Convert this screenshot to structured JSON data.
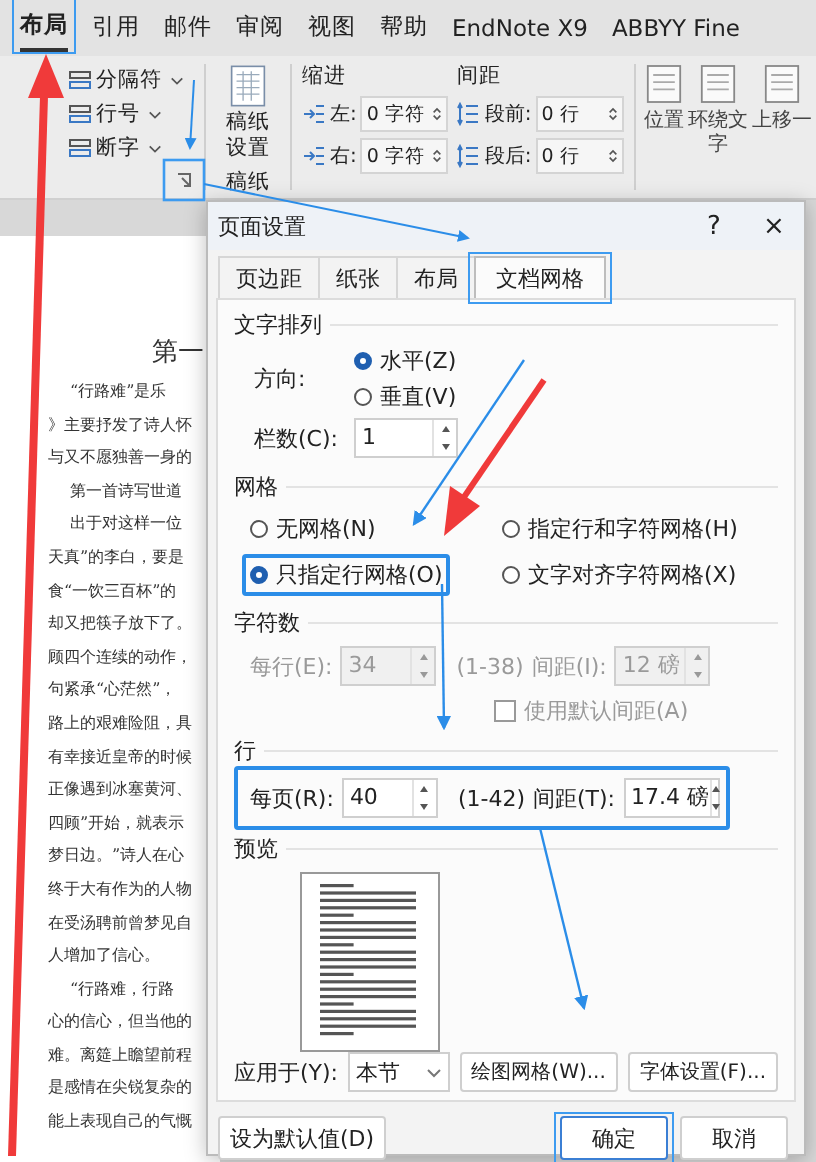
{
  "ribbon": {
    "tabs": [
      {
        "label": "布局",
        "selected": true
      },
      {
        "label": "引用",
        "selected": false
      },
      {
        "label": "邮件",
        "selected": false
      },
      {
        "label": "审阅",
        "selected": false
      },
      {
        "label": "视图",
        "selected": false
      },
      {
        "label": "帮助",
        "selected": false
      },
      {
        "label": "EndNote X9",
        "selected": false
      },
      {
        "label": "ABBYY Fine",
        "selected": false
      }
    ],
    "page_setup": [
      {
        "label": "分隔符"
      },
      {
        "label": "行号"
      },
      {
        "label": "断字"
      }
    ],
    "manuscript": {
      "button_lines": [
        "稿纸",
        "设置"
      ],
      "group_label": "稿纸"
    },
    "paragraph": {
      "indent_label": "缩进",
      "spacing_label": "间距",
      "indent": [
        {
          "label": "左:",
          "value": "0 字符"
        },
        {
          "label": "右:",
          "value": "0 字符"
        }
      ],
      "spacing": [
        {
          "label": "段前:",
          "value": "0 行"
        },
        {
          "label": "段后:",
          "value": "0 行"
        }
      ]
    },
    "arrange": [
      {
        "lines": [
          "位置"
        ]
      },
      {
        "lines": [
          "环绕文",
          "字"
        ]
      },
      {
        "lines": [
          "上移一"
        ]
      }
    ]
  },
  "document": {
    "lines": [
      {
        "text": "第一",
        "kind": "heading"
      },
      {
        "text": "“行路难”是乐",
        "kind": "indent"
      },
      {
        "text": "》主要抒发了诗人怀",
        "kind": "body"
      },
      {
        "text": "与又不愿独善一身的",
        "kind": "body"
      },
      {
        "text": "第一首诗写世道",
        "kind": "indent"
      },
      {
        "text": "出于对这样一位",
        "kind": "indent"
      },
      {
        "text": "天真”的李白，要是",
        "kind": "body"
      },
      {
        "text": "食“一饮三百杯”的",
        "kind": "body"
      },
      {
        "text": "却又把筷子放下了。",
        "kind": "body"
      },
      {
        "text": "顾四个连续的动作，",
        "kind": "body"
      },
      {
        "text": "句紧承“心茫然”，",
        "kind": "body"
      },
      {
        "text": "路上的艰难险阻，具",
        "kind": "body"
      },
      {
        "text": "有幸接近皇帝的时候",
        "kind": "body"
      },
      {
        "text": "正像遇到冰塞黄河、",
        "kind": "body"
      },
      {
        "text": "四顾”开始，就表示",
        "kind": "body"
      },
      {
        "text": "梦日边。”诗人在心",
        "kind": "body"
      },
      {
        "text": "终于大有作为的人物",
        "kind": "body"
      },
      {
        "text": "在受汤聘前曾梦见自",
        "kind": "body"
      },
      {
        "text": "人增加了信心。",
        "kind": "body"
      },
      {
        "text": "“行路难，行路",
        "kind": "indent"
      },
      {
        "text": "心的信心，但当他的",
        "kind": "body"
      },
      {
        "text": "难。离筵上瞻望前程",
        "kind": "body"
      },
      {
        "text": "是感情在尖锐复杂的",
        "kind": "body"
      },
      {
        "text": "能上表现自己的气慨",
        "kind": "body"
      }
    ]
  },
  "dialog": {
    "title": "页面设置",
    "help": "?",
    "close": "×",
    "tabs": [
      {
        "label": "页边距",
        "selected": false
      },
      {
        "label": "纸张",
        "selected": false
      },
      {
        "label": "布局",
        "selected": false
      },
      {
        "label": "文档网格",
        "selected": true
      }
    ],
    "text_direction": {
      "heading": "文字排列",
      "direction_label": "方向:",
      "options": [
        {
          "label": "水平(Z)",
          "selected": true
        },
        {
          "label": "垂直(V)",
          "selected": false
        }
      ],
      "columns_label": "栏数(C):",
      "columns": "1"
    },
    "grid": {
      "heading": "网格",
      "options": [
        {
          "label": "无网格(N)",
          "selected": false
        },
        {
          "label": "指定行和字符网格(H)",
          "selected": false
        },
        {
          "label": "只指定行网格(O)",
          "selected": true
        },
        {
          "label": "文字对齐字符网格(X)",
          "selected": false
        }
      ]
    },
    "characters": {
      "heading": "字符数",
      "disabled": true,
      "per_line_label": "每行(E):",
      "per_line": "34",
      "range": "(1-38)",
      "pitch_label": "间距(I):",
      "pitch": "12 磅",
      "default_pitch": {
        "label": "使用默认间距(A)",
        "checked": false
      }
    },
    "lines": {
      "heading": "行",
      "per_page_label": "每页(R):",
      "per_page": "40",
      "range": "(1-42)",
      "pitch_label": "间距(T):",
      "pitch": "17.4 磅"
    },
    "preview_heading": "预览",
    "apply_label": "应用于(Y):",
    "apply_to": "本节",
    "buttons": [
      "绘图网格(W)...",
      "字体设置(F)..."
    ],
    "default_button": "设为默认值(D)",
    "ok": "确定",
    "cancel": "取消"
  }
}
